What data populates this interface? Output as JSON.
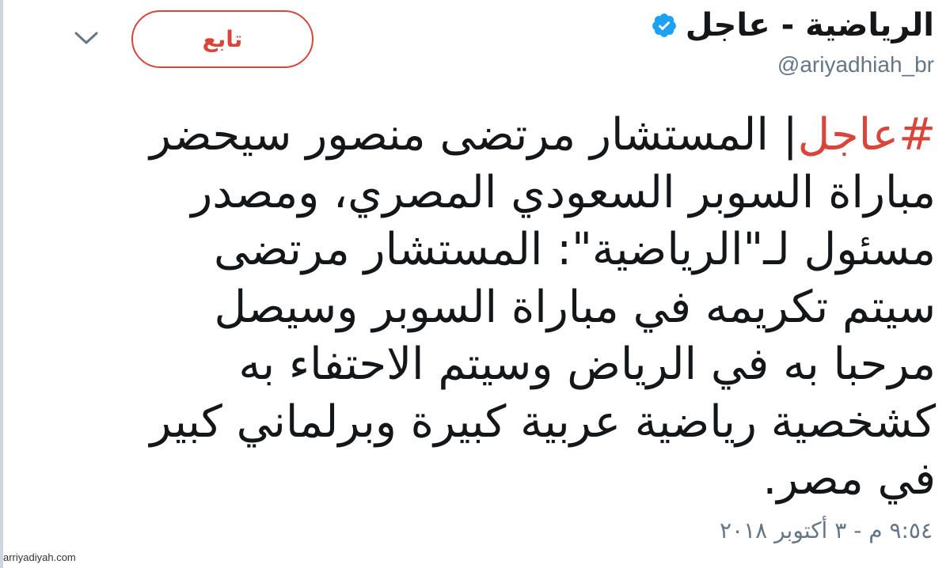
{
  "header": {
    "display_name": "الرياضية - عاجل",
    "handle": "@ariyadhiah_br",
    "verified_icon": "verified-badge-icon",
    "follow_label": "تابع",
    "more_icon": "chevron-down-icon"
  },
  "tweet": {
    "hashtag": "#عاجل",
    "lines": [
      "| المستشار مرتضى منصور سيحضر",
      "مباراة السوبر السعودي المصري، ومصدر",
      "مسئول لـ\"الرياضية\": المستشار مرتضى",
      "سيتم تكريمه في مباراة السوبر وسيصل",
      "مرحبا به في الرياض وسيتم الاحتفاء به",
      "كشخصية رياضية عربية كبيرة وبرلماني كبير",
      "في مصر."
    ],
    "timestamp": "٩:٥٤ م - ٣ أكتوبر ٢٠١٨"
  },
  "watermark": "arriyadiyah.com",
  "colors": {
    "accent": "#d7453b",
    "verified": "#1da1f2",
    "muted": "#657786",
    "text": "#14171a"
  }
}
